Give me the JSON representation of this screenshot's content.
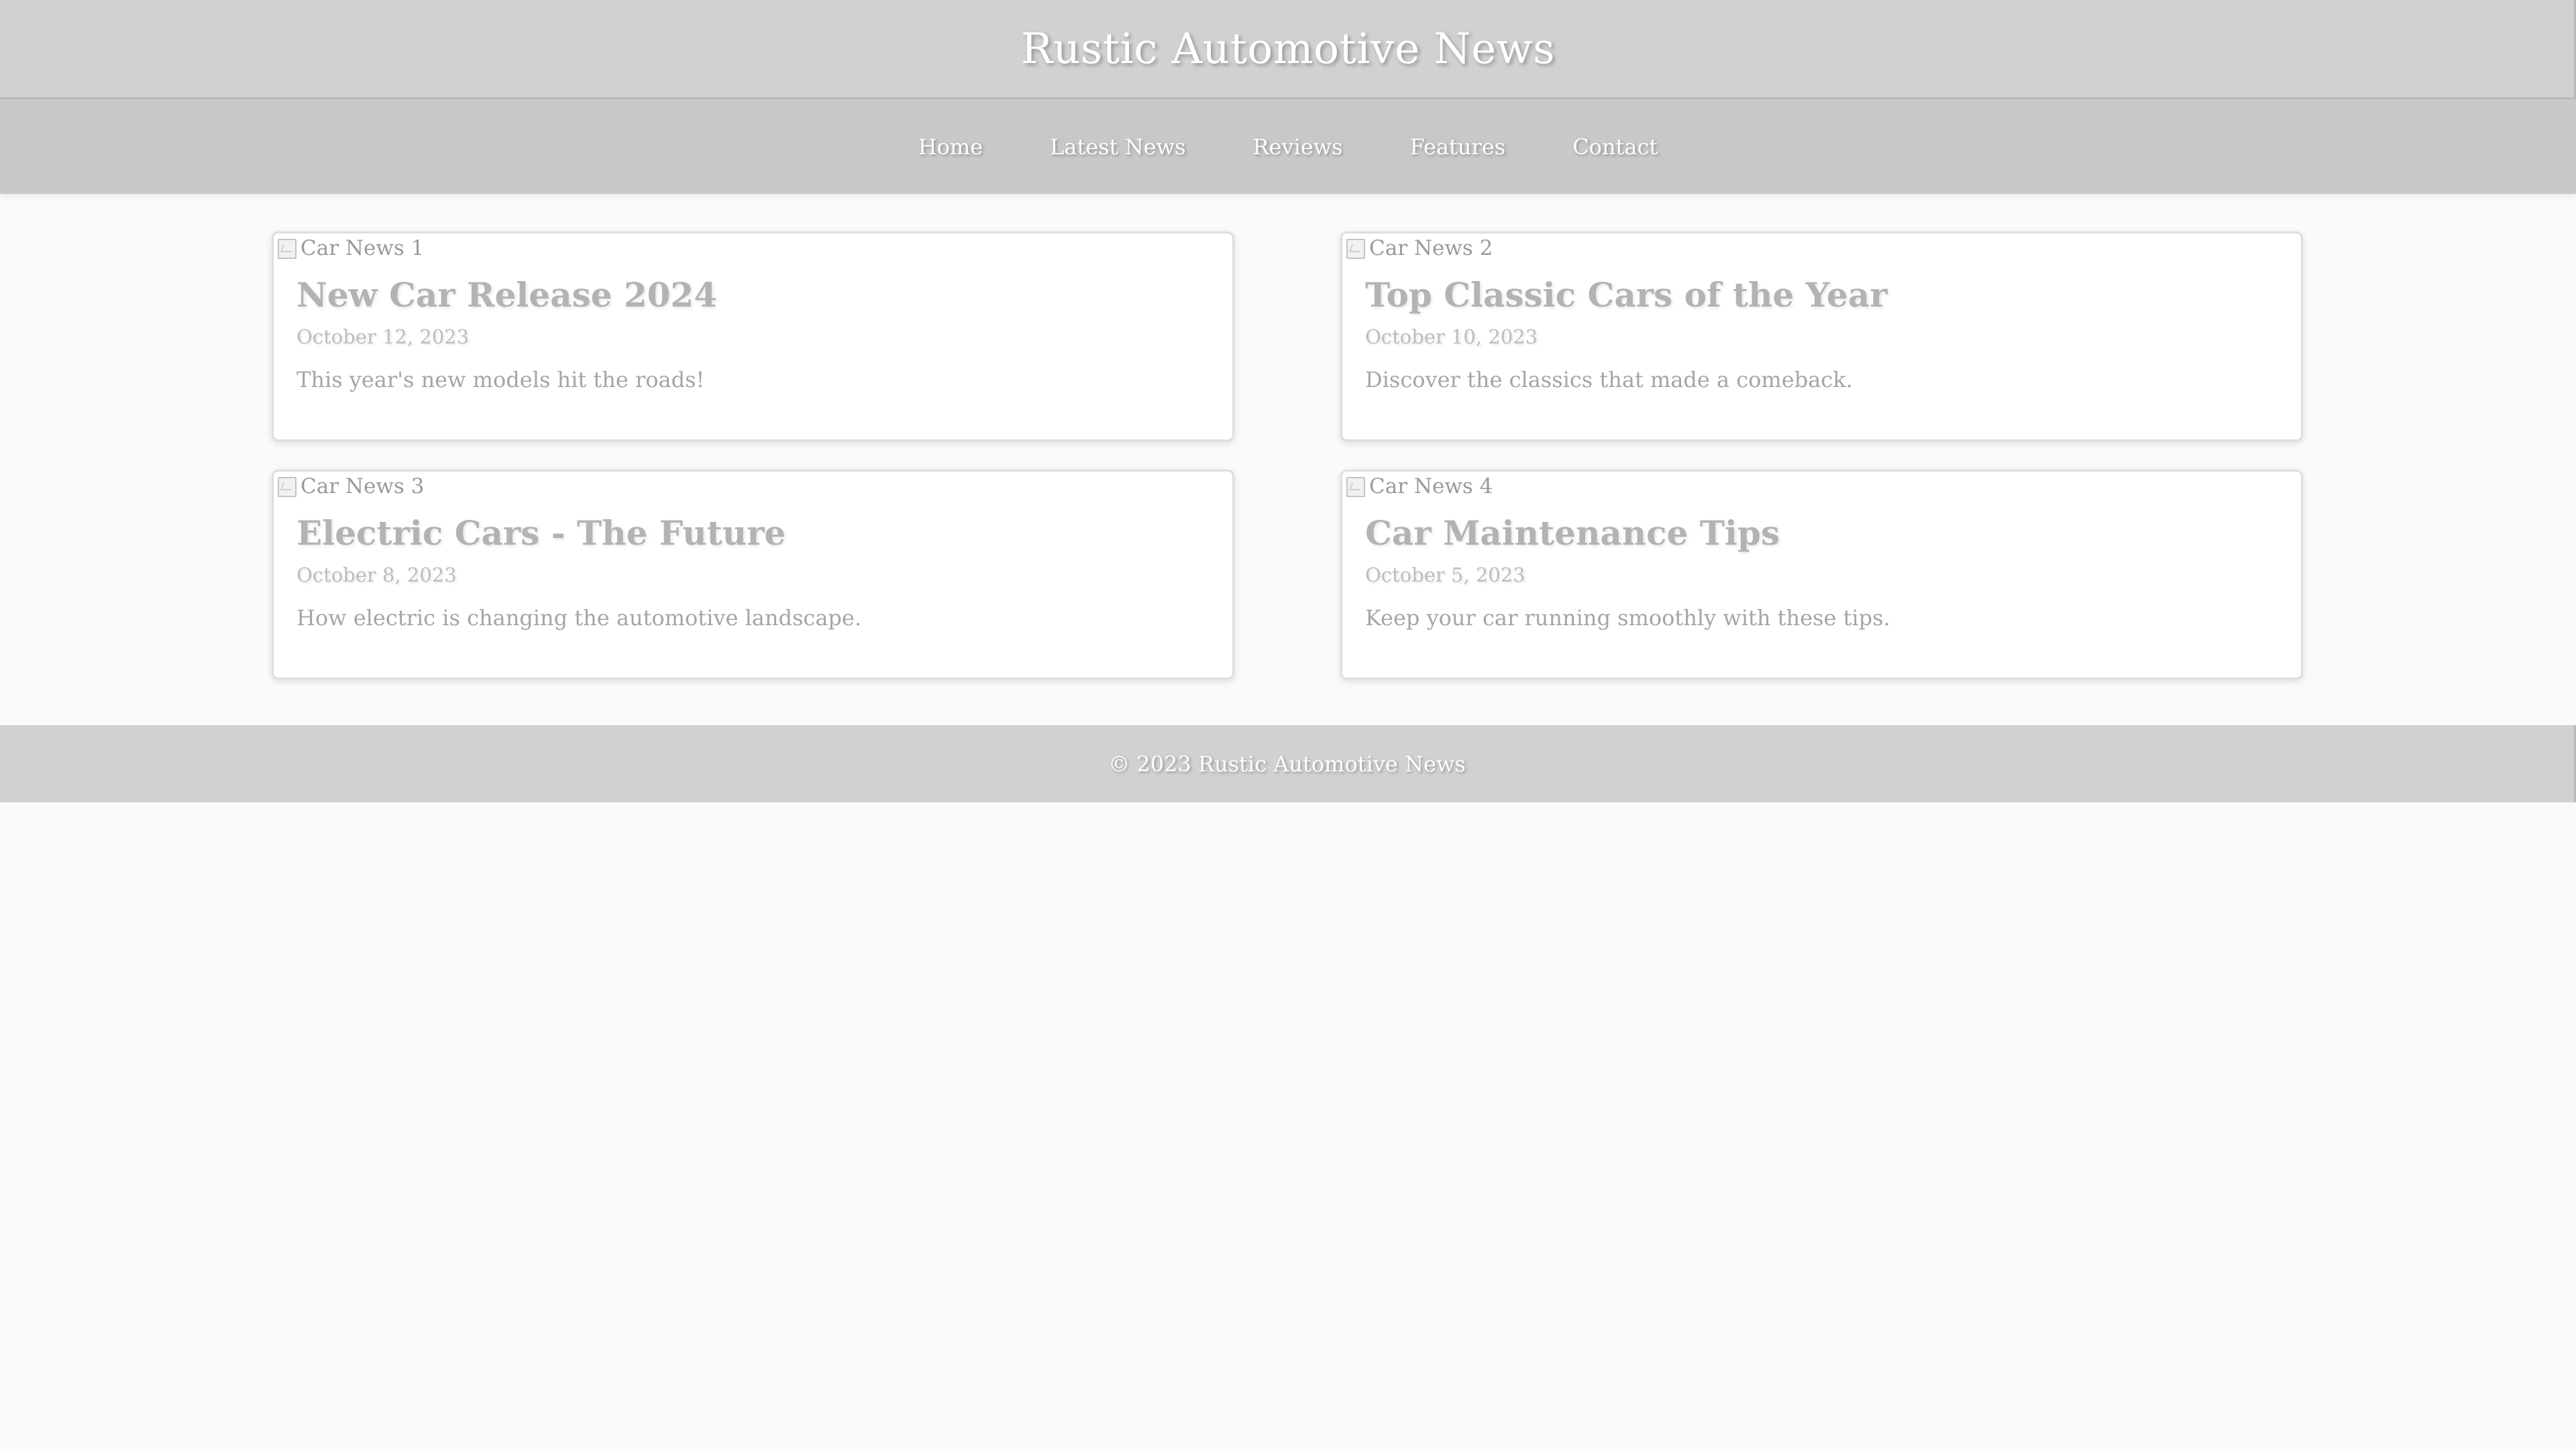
{
  "header": {
    "title": "Rustic Automotive News"
  },
  "nav": {
    "items": [
      {
        "label": "Home"
      },
      {
        "label": "Latest News"
      },
      {
        "label": "Reviews"
      },
      {
        "label": "Features"
      },
      {
        "label": "Contact"
      }
    ]
  },
  "articles": [
    {
      "image_alt": "Car News 1",
      "title": "New Car Release 2024",
      "date": "October 12, 2023",
      "description": "This year's new models hit the roads!"
    },
    {
      "image_alt": "Car News 2",
      "title": "Top Classic Cars of the Year",
      "date": "October 10, 2023",
      "description": "Discover the classics that made a comeback."
    },
    {
      "image_alt": "Car News 3",
      "title": "Electric Cars - The Future",
      "date": "October 8, 2023",
      "description": "How electric is changing the automotive landscape."
    },
    {
      "image_alt": "Car News 4",
      "title": "Car Maintenance Tips",
      "date": "October 5, 2023",
      "description": "Keep your car running smoothly with these tips."
    }
  ],
  "footer": {
    "text": "© 2023 Rustic Automotive News"
  },
  "icons": {
    "broken_image": "broken-image-icon"
  },
  "colors": {
    "header_bg": "#d1d1d1",
    "nav_bg": "#c8c8c8",
    "page_bg": "#fafafa",
    "card_title": "#b3b3b3"
  }
}
